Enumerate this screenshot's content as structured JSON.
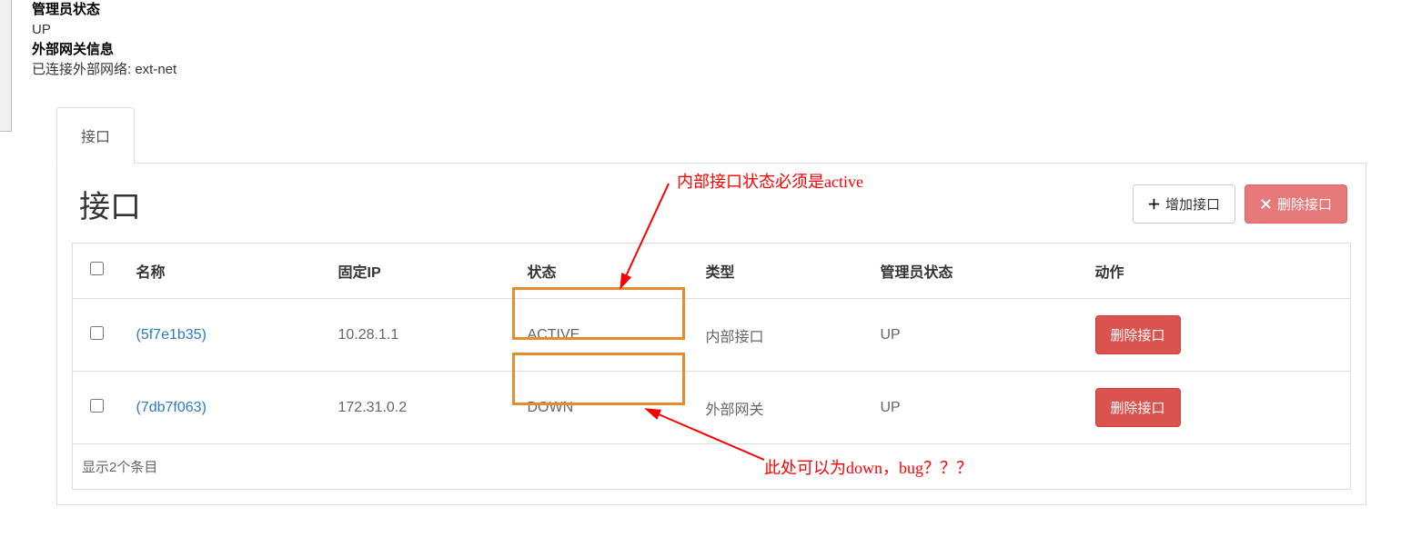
{
  "top": {
    "admin_status_label": "管理员状态",
    "admin_status_value": "UP",
    "ext_gw_label": "外部网关信息",
    "ext_gw_text": "已连接外部网络: ext-net"
  },
  "tab": {
    "label": "接口"
  },
  "page_title": "接口",
  "buttons": {
    "add": "增加接口",
    "delete_top": "删除接口",
    "row_delete": "删除接口"
  },
  "columns": {
    "name": "名称",
    "fixed_ip": "固定IP",
    "status": "状态",
    "type": "类型",
    "admin_state": "管理员状态",
    "action": "动作"
  },
  "rows": [
    {
      "name": "(5f7e1b35)",
      "ip": "10.28.1.1",
      "status": "ACTIVE",
      "type": "内部接口",
      "admin": "UP"
    },
    {
      "name": "(7db7f063)",
      "ip": "172.31.0.2",
      "status": "DOWN",
      "type": "外部网关",
      "admin": "UP"
    }
  ],
  "footer_text": "显示2个条目",
  "annotations": {
    "top": "内部接口状态必须是active",
    "bottom": "此处可以为down，bug？？？"
  }
}
